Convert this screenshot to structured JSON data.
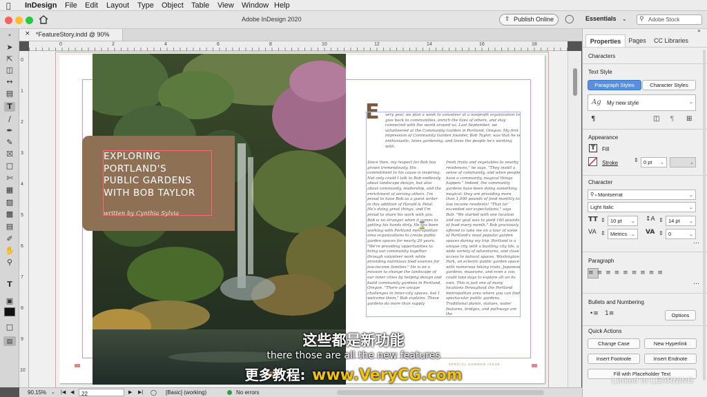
{
  "menubar": {
    "app_name": "InDesign",
    "items": [
      "File",
      "Edit",
      "Layout",
      "Type",
      "Object",
      "Table",
      "View",
      "Window",
      "Help"
    ]
  },
  "titlebar": {
    "title": "Adobe InDesign 2020",
    "publish_label": "Publish Online",
    "workspace_label": "Essentials",
    "search_placeholder": "Adobe Stock"
  },
  "document_tab": {
    "label": "*FeatureStory.indd @ 90%"
  },
  "rulers": {
    "top_ticks": [
      "0",
      "2",
      "4",
      "6",
      "8",
      "10",
      "12",
      "14",
      "16",
      "18"
    ],
    "left_ticks": [
      "0",
      "1",
      "2",
      "3",
      "4",
      "5",
      "6",
      "7",
      "8",
      "9",
      "10"
    ]
  },
  "spread": {
    "title_lines": [
      "EXPLORING",
      "PORTLAND'S",
      "PUBLIC GARDENS",
      "WITH BOB TAYLOR"
    ],
    "byline": "written by Cynthia Sylvia",
    "drop_cap": "E",
    "intro": "very year, we plan a week to volunteer at a nonprofit organization to give back to communities, enrich the lives of others, and stay connected with the world around us. Last September, we volunteered at the Community Garden in Portland, Oregon. My first impression of Community Garden founder, Bob Taylor, was that he is enthusiastic, loves gardening, and loves the people he's working with.",
    "col1": "Since then, my respect for Bob has grown tremendously. His commitment to his cause is inspiring. Not only could I talk to Bob endlessly about landscape design, but also about community, leadership, and the enrichment of serving others. I'm proud to have Bob as a guest writer in this addition of Harald & Petal. He's doing great things, and I'm proud to share his work with you. Bob is no stranger when it comes to getting his hands dirty. He has been working with Portland metropolitan area organizations to create public garden spaces for nearly 20 years. \"We're providing opportunities to bring our community together through volunteer work while providing nutritious food sources for low-income families.\" He is on a mission to change the landscape of our inner cities by helping design and build community gardens in Portland, Oregon. \"There are unique challenges in inner-city spaces, but I welcome them,\" Bob explains. These gardens do more than supply",
    "col2": "fresh fruits and vegetables to nearby residences,\" he says. \"They instill a sense of community, and when people have a community, magical things happen.\" Indeed, the community gardens have been doing something magical: they are providing more than 1,000 pounds of food monthly to low income residents! \"That far exceeded our expectations,\" says Bob. \"We started with one location and our goal was to yield 100 pounds of food every month.\" Bob graciously offered to take me on a tour of some of Portland's most popular garden spaces during my trip. Portland is a unique city with a bustling city life, a wide variety of adventures, and close access to natural spaces. Washington Park, an eclectic public garden space with numerous hiking trails, Japanese gardens, museums, and even a zoo, could take days to explore all on its own. This is just one of many locations throughout the Portland metropolitan area where you can find spectacular public gardens. Traditional plants, statues, water features, bridges, and pathways are the",
    "folio_right": "SPECIAL SUMMER ISSUE"
  },
  "panel": {
    "tabs": [
      "Properties",
      "Pages",
      "CC Libraries"
    ],
    "selection_type": "Characters",
    "text_style_heading": "Text Style",
    "paragraph_styles_label": "Paragraph Styles",
    "character_styles_label": "Character Styles",
    "style_sample": "Ag",
    "style_name": "My new style",
    "appearance_heading": "Appearance",
    "fill_label": "Fill",
    "stroke_label": "Stroke",
    "stroke_weight": "0 pt",
    "character_heading": "Character",
    "font_family": "Montserrat",
    "font_style": "Light Italic",
    "font_size": "10 pt",
    "leading": "14 pt",
    "kerning": "Metrics",
    "tracking": "0",
    "paragraph_heading": "Paragraph",
    "bullets_heading": "Bullets and Numbering",
    "options_label": "Options",
    "quick_actions_heading": "Quick Actions",
    "actions": [
      "Change Case",
      "New Hyperlink",
      "Insert Footnote",
      "Insert Endnote",
      "Fill with Placeholder Text"
    ]
  },
  "statusbar": {
    "zoom": "90.15%",
    "page": "22",
    "style_state": "[Basic] (working)",
    "preflight": "No errors"
  },
  "overlays": {
    "subtitle_cn": "这些都是新功能",
    "subtitle_en": "there those are all the new features",
    "promo_label": "更多教程:",
    "promo_site": "www.VeryCG.com",
    "watermark": "Linked in LEARNING"
  },
  "colors": {
    "accent_blue": "#1473e6",
    "title_box": "#8e7055",
    "drop_cap": "#7a5a3f",
    "promo_yellow": "#f5c400"
  },
  "icons": [
    "apple-icon",
    "home-icon",
    "bulb-icon",
    "search-icon",
    "close-icon",
    "selection-tool-icon",
    "type-tool-icon",
    "pen-tool-icon",
    "hand-tool-icon",
    "zoom-tool-icon"
  ]
}
